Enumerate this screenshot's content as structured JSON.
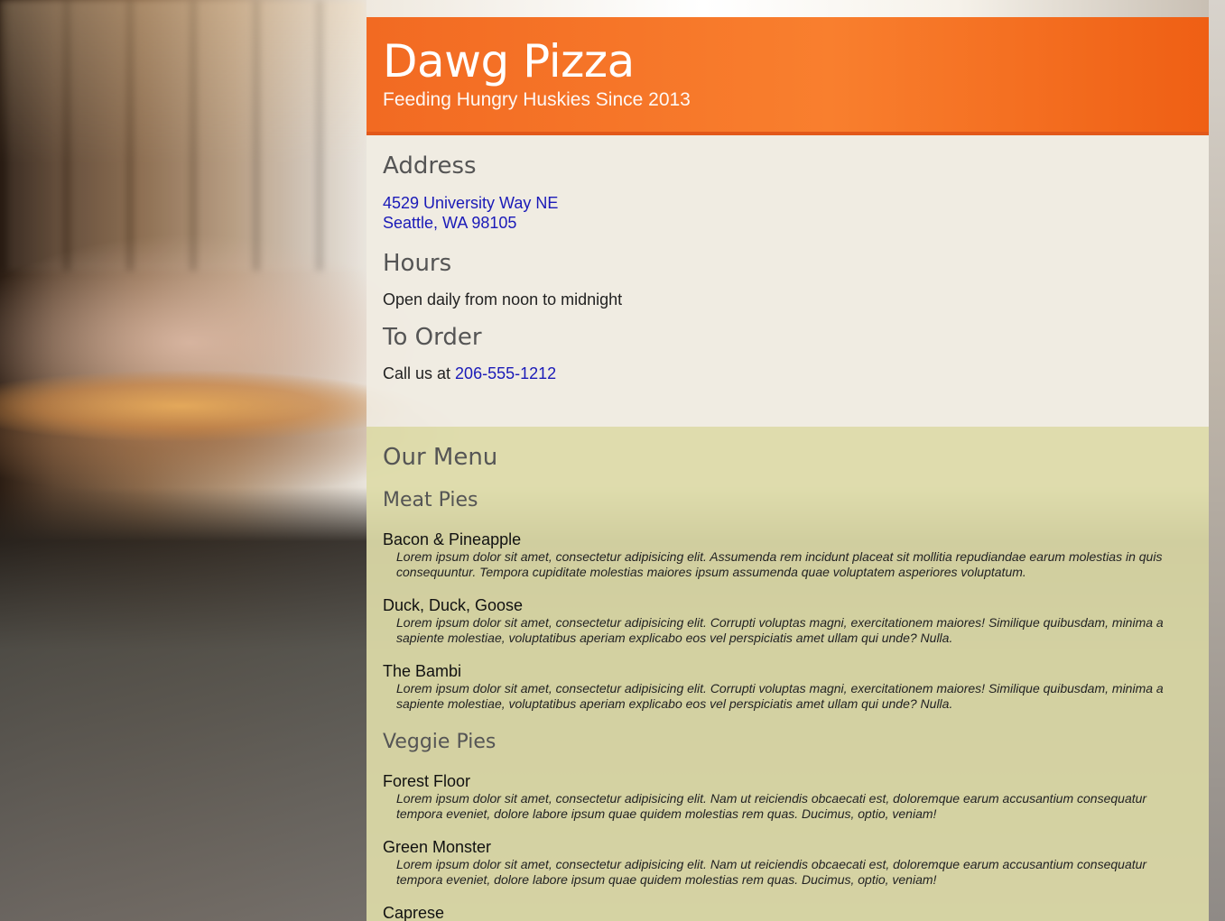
{
  "header": {
    "title": "Dawg Pizza",
    "tagline": "Feeding Hungry Huskies Since 2013"
  },
  "info": {
    "address_heading": "Address",
    "address_line1": "4529 University Way NE",
    "address_line2": "Seattle, WA 98105",
    "hours_heading": "Hours",
    "hours_text": "Open daily from noon to midnight",
    "order_heading": "To Order",
    "order_prefix": "Call us at ",
    "phone": "206-555-1212"
  },
  "menu": {
    "heading": "Our Menu",
    "categories": [
      {
        "name": "Meat Pies",
        "items": [
          {
            "name": "Bacon & Pineapple",
            "description": "Lorem ipsum dolor sit amet, consectetur adipisicing elit. Assumenda rem incidunt placeat sit mollitia repudiandae earum molestias in quis consequuntur. Tempora cupiditate molestias maiores ipsum assumenda quae voluptatem asperiores voluptatum."
          },
          {
            "name": "Duck, Duck, Goose",
            "description": "Lorem ipsum dolor sit amet, consectetur adipisicing elit. Corrupti voluptas magni, exercitationem maiores! Similique quibusdam, minima a sapiente molestiae, voluptatibus aperiam explicabo eos vel perspiciatis amet ullam qui unde? Nulla."
          },
          {
            "name": "The Bambi",
            "description": "Lorem ipsum dolor sit amet, consectetur adipisicing elit. Corrupti voluptas magni, exercitationem maiores! Similique quibusdam, minima a sapiente molestiae, voluptatibus aperiam explicabo eos vel perspiciatis amet ullam qui unde? Nulla."
          }
        ]
      },
      {
        "name": "Veggie Pies",
        "items": [
          {
            "name": "Forest Floor",
            "description": "Lorem ipsum dolor sit amet, consectetur adipisicing elit. Nam ut reiciendis obcaecati est, doloremque earum accusantium consequatur tempora eveniet, dolore labore ipsum quae quidem molestias rem quas. Ducimus, optio, veniam!"
          },
          {
            "name": "Green Monster",
            "description": "Lorem ipsum dolor sit amet, consectetur adipisicing elit. Nam ut reiciendis obcaecati est, doloremque earum accusantium consequatur tempora eveniet, dolore labore ipsum quae quidem molestias rem quas. Ducimus, optio, veniam!"
          },
          {
            "name": "Caprese",
            "description": ""
          }
        ]
      }
    ]
  },
  "colors": {
    "header_orange": "#f26a22",
    "link_blue": "#1a1ab8",
    "menu_bg": "#dddba8",
    "info_bg": "#f1ece2"
  }
}
